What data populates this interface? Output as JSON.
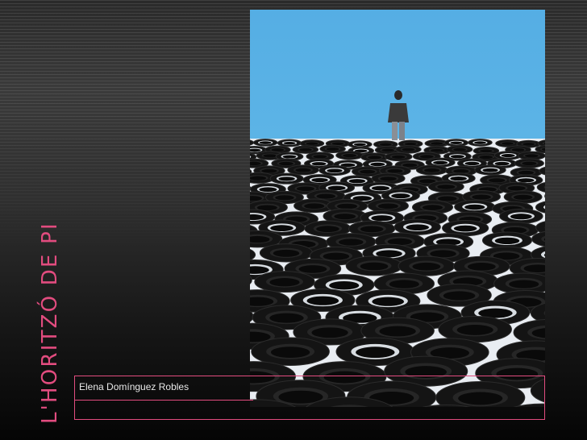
{
  "slide": {
    "title": "L'HORITZÓ DE PI",
    "author": "Elena Domínguez Robles"
  },
  "photo": {
    "subject": "person-standing-on-tire-field",
    "colors": {
      "sky": "#5fb4e4",
      "tire": "#151515",
      "ground": "#eef1f4",
      "accent": "#e24c7f"
    }
  }
}
